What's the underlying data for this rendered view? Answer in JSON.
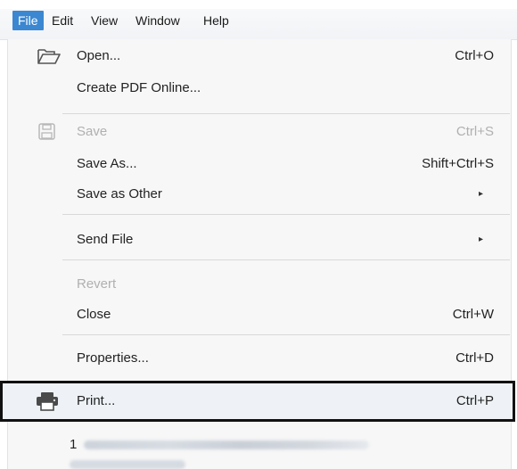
{
  "menubar": {
    "items": [
      {
        "label": "File",
        "active": true
      },
      {
        "label": "Edit"
      },
      {
        "label": "View"
      },
      {
        "label": "Window"
      },
      {
        "label": "Help"
      }
    ]
  },
  "menu": {
    "open": {
      "label": "Open...",
      "shortcut": "Ctrl+O",
      "icon": "folder-open-icon"
    },
    "create_pdf": {
      "label": "Create PDF Online..."
    },
    "save": {
      "label": "Save",
      "shortcut": "Ctrl+S",
      "icon": "save-icon",
      "disabled": true
    },
    "save_as": {
      "label": "Save As...",
      "shortcut": "Shift+Ctrl+S"
    },
    "save_as_other": {
      "label": "Save as Other",
      "submenu_indicator": "▸"
    },
    "send_file": {
      "label": "Send File",
      "submenu_indicator": "▸"
    },
    "revert": {
      "label": "Revert",
      "disabled": true
    },
    "close": {
      "label": "Close",
      "shortcut": "Ctrl+W"
    },
    "properties": {
      "label": "Properties...",
      "shortcut": "Ctrl+D"
    },
    "print": {
      "label": "Print...",
      "shortcut": "Ctrl+P",
      "icon": "printer-icon",
      "highlighted": true
    },
    "recent": {
      "index": "1"
    }
  },
  "colors": {
    "accent": "#3c87d1",
    "panel_bg": "#f7f7f7",
    "disabled_text": "#b0b0b0",
    "highlight_border": "#111111"
  }
}
